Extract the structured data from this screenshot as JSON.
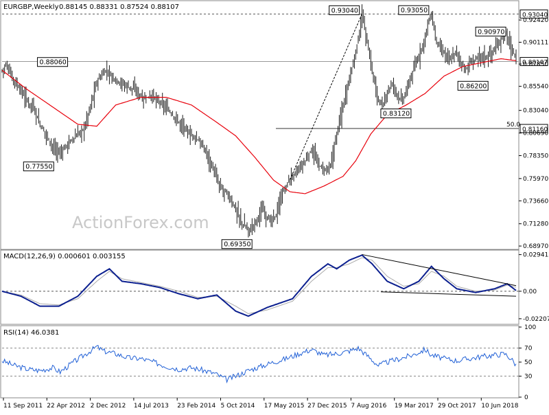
{
  "chart_data": [
    {
      "type": "ohlc",
      "title": "EURGBP,Weekly",
      "ohlc_label": "0.88145 0.88331 0.87524 0.88107",
      "ylim": [
        0.6869,
        0.9435
      ],
      "y_ticks": [
        "0.92420",
        "0.90111",
        "0.87850",
        "0.85540",
        "0.83040",
        "0.80690",
        "0.78350",
        "0.75970",
        "0.73660",
        "0.71280",
        "0.68970"
      ],
      "y_tick_values": [
        0.9242,
        0.90111,
        0.8785,
        0.8554,
        0.8304,
        0.8069,
        0.7835,
        0.7597,
        0.7366,
        0.7128,
        0.6897
      ],
      "x_labels": [
        "11 Sep 2011",
        "22 Apr 2012",
        "2 Dec 2012",
        "14 Jul 2013",
        "23 Feb 2014",
        "5 Oct 2014",
        "17 May 2015",
        "27 Dec 2015",
        "7 Aug 2016",
        "19 Mar 2017",
        "29 Oct 2017",
        "10 Jun 2018"
      ],
      "price_path": [
        [
          0,
          0.872
        ],
        [
          3,
          0.878
        ],
        [
          8,
          0.864
        ],
        [
          14,
          0.852
        ],
        [
          20,
          0.84
        ],
        [
          25,
          0.833
        ],
        [
          30,
          0.815
        ],
        [
          35,
          0.805
        ],
        [
          41,
          0.79
        ],
        [
          46,
          0.786
        ],
        [
          52,
          0.796
        ],
        [
          58,
          0.803
        ],
        [
          65,
          0.812
        ],
        [
          75,
          0.86
        ],
        [
          82,
          0.872
        ],
        [
          88,
          0.864
        ],
        [
          95,
          0.858
        ],
        [
          105,
          0.852
        ],
        [
          112,
          0.842
        ],
        [
          118,
          0.846
        ],
        [
          125,
          0.838
        ],
        [
          132,
          0.83
        ],
        [
          140,
          0.818
        ],
        [
          148,
          0.806
        ],
        [
          155,
          0.8
        ],
        [
          162,
          0.786
        ],
        [
          168,
          0.766
        ],
        [
          172,
          0.752
        ],
        [
          178,
          0.744
        ],
        [
          184,
          0.73
        ],
        [
          190,
          0.712
        ],
        [
          196,
          0.706
        ],
        [
          201,
          0.716
        ],
        [
          206,
          0.728
        ],
        [
          212,
          0.715
        ],
        [
          217,
          0.722
        ],
        [
          222,
          0.745
        ],
        [
          228,
          0.76
        ],
        [
          234,
          0.768
        ],
        [
          240,
          0.778
        ],
        [
          245,
          0.79
        ],
        [
          250,
          0.775
        ],
        [
          255,
          0.768
        ],
        [
          260,
          0.772
        ],
        [
          265,
          0.808
        ],
        [
          270,
          0.836
        ],
        [
          274,
          0.86
        ],
        [
          278,
          0.88
        ],
        [
          282,
          0.905
        ],
        [
          285,
          0.93
        ],
        [
          289,
          0.9
        ],
        [
          293,
          0.87
        ],
        [
          297,
          0.845
        ],
        [
          301,
          0.833
        ],
        [
          305,
          0.85
        ],
        [
          309,
          0.858
        ],
        [
          313,
          0.846
        ],
        [
          317,
          0.84
        ],
        [
          321,
          0.855
        ],
        [
          325,
          0.87
        ],
        [
          329,
          0.884
        ],
        [
          333,
          0.898
        ],
        [
          337,
          0.92
        ],
        [
          340,
          0.93
        ],
        [
          343,
          0.905
        ],
        [
          347,
          0.894
        ],
        [
          351,
          0.888
        ],
        [
          355,
          0.882
        ],
        [
          359,
          0.892
        ],
        [
          363,
          0.88
        ],
        [
          367,
          0.872
        ],
        [
          371,
          0.88
        ],
        [
          375,
          0.884
        ],
        [
          379,
          0.888
        ],
        [
          383,
          0.885
        ],
        [
          387,
          0.89
        ],
        [
          391,
          0.895
        ],
        [
          395,
          0.904
        ],
        [
          399,
          0.91
        ],
        [
          402,
          0.898
        ],
        [
          405,
          0.889
        ],
        [
          407,
          0.881
        ]
      ],
      "ma_path": [
        [
          0,
          0.872
        ],
        [
          20,
          0.852
        ],
        [
          40,
          0.834
        ],
        [
          60,
          0.816
        ],
        [
          75,
          0.814
        ],
        [
          90,
          0.836
        ],
        [
          110,
          0.844
        ],
        [
          130,
          0.844
        ],
        [
          150,
          0.836
        ],
        [
          170,
          0.818
        ],
        [
          185,
          0.804
        ],
        [
          200,
          0.782
        ],
        [
          215,
          0.758
        ],
        [
          228,
          0.746
        ],
        [
          240,
          0.744
        ],
        [
          255,
          0.752
        ],
        [
          270,
          0.762
        ],
        [
          280,
          0.778
        ],
        [
          292,
          0.806
        ],
        [
          305,
          0.826
        ],
        [
          320,
          0.836
        ],
        [
          335,
          0.848
        ],
        [
          350,
          0.866
        ],
        [
          365,
          0.876
        ],
        [
          380,
          0.88
        ],
        [
          395,
          0.884
        ],
        [
          407,
          0.882
        ]
      ],
      "x_max": 407,
      "horizontal_levels": [
        {
          "value": 0.9304,
          "label": "0.93040",
          "style": "dashed"
        },
        {
          "value": 0.8811,
          "label": "0.88107",
          "style": "solid-grey"
        },
        {
          "value": 0.8116,
          "label": "0.81160",
          "style": "solid-dark"
        }
      ],
      "fib_label": "50.0",
      "annotations": [
        {
          "label": "0.88060",
          "x": 53,
          "y": 0.8806
        },
        {
          "label": "0.77550",
          "x": 42,
          "y": 0.7755
        },
        {
          "label": "0.69350",
          "x": 199,
          "y": 0.6935
        },
        {
          "label": "0.93040",
          "x": 284,
          "y": 0.9304
        },
        {
          "label": "0.93050",
          "x": 339,
          "y": 0.9305
        },
        {
          "label": "0.83120",
          "x": 301,
          "y": 0.8312
        },
        {
          "label": "0.86200",
          "x": 362,
          "y": 0.862
        },
        {
          "label": "0.90970",
          "x": 400,
          "y": 0.9097
        }
      ],
      "trendline": {
        "from": [
          228,
          0.7585
        ],
        "to": [
          285,
          0.9304
        ]
      }
    },
    {
      "type": "line",
      "title": "MACD(12,26,9) 0.000601 0.003155",
      "ylim": [
        -0.026,
        0.0325
      ],
      "y_ticks": [
        "0.029412",
        "0.00",
        "-0.022074"
      ],
      "y_tick_values": [
        0.029412,
        0.0,
        -0.022074
      ],
      "series": [
        {
          "name": "macd",
          "values": [
            [
              0,
              0.0
            ],
            [
              15,
              -0.004
            ],
            [
              30,
              -0.012
            ],
            [
              45,
              -0.012
            ],
            [
              60,
              -0.004
            ],
            [
              75,
              0.012
            ],
            [
              85,
              0.018
            ],
            [
              95,
              0.008
            ],
            [
              110,
              0.006
            ],
            [
              125,
              0.003
            ],
            [
              140,
              -0.002
            ],
            [
              155,
              -0.006
            ],
            [
              170,
              -0.003
            ],
            [
              185,
              -0.016
            ],
            [
              195,
              -0.02
            ],
            [
              210,
              -0.013
            ],
            [
              230,
              -0.006
            ],
            [
              245,
              0.012
            ],
            [
              258,
              0.022
            ],
            [
              265,
              0.018
            ],
            [
              275,
              0.025
            ],
            [
              285,
              0.029
            ],
            [
              293,
              0.022
            ],
            [
              305,
              0.008
            ],
            [
              318,
              0.002
            ],
            [
              330,
              0.008
            ],
            [
              340,
              0.02
            ],
            [
              350,
              0.01
            ],
            [
              360,
              0.002
            ],
            [
              375,
              -0.001
            ],
            [
              390,
              0.002
            ],
            [
              400,
              0.006
            ],
            [
              407,
              0.0006
            ]
          ]
        },
        {
          "name": "signal",
          "values": [
            [
              0,
              0.0
            ],
            [
              15,
              -0.003
            ],
            [
              30,
              -0.01
            ],
            [
              45,
              -0.011
            ],
            [
              60,
              -0.006
            ],
            [
              75,
              0.008
            ],
            [
              85,
              0.016
            ],
            [
              95,
              0.01
            ],
            [
              110,
              0.007
            ],
            [
              125,
              0.004
            ],
            [
              140,
              0.0
            ],
            [
              155,
              -0.005
            ],
            [
              170,
              -0.004
            ],
            [
              185,
              -0.012
            ],
            [
              195,
              -0.018
            ],
            [
              210,
              -0.015
            ],
            [
              230,
              -0.008
            ],
            [
              245,
              0.008
            ],
            [
              258,
              0.019
            ],
            [
              265,
              0.019
            ],
            [
              275,
              0.022
            ],
            [
              285,
              0.027
            ],
            [
              293,
              0.025
            ],
            [
              305,
              0.012
            ],
            [
              318,
              0.004
            ],
            [
              330,
              0.006
            ],
            [
              340,
              0.016
            ],
            [
              350,
              0.012
            ],
            [
              360,
              0.004
            ],
            [
              375,
              0.0
            ],
            [
              390,
              0.001
            ],
            [
              400,
              0.005
            ],
            [
              407,
              0.0032
            ]
          ]
        }
      ],
      "trendlines": [
        {
          "from": [
            285,
            0.0295
          ],
          "to": [
            407,
            0.0045
          ]
        },
        {
          "from": [
            300,
            -0.0005
          ],
          "to": [
            407,
            -0.004
          ]
        }
      ]
    },
    {
      "type": "line",
      "title": "RSI(14) 46.0381",
      "ylim": [
        0,
        100
      ],
      "y_ticks": [
        "100",
        "70",
        "50",
        "30",
        "0"
      ],
      "y_tick_values": [
        100,
        70,
        50,
        30,
        0
      ],
      "dashed_levels": [
        70,
        30
      ],
      "series": [
        {
          "name": "rsi",
          "values": [
            [
              0,
              52
            ],
            [
              10,
              45
            ],
            [
              20,
              40
            ],
            [
              30,
              38
            ],
            [
              40,
              42
            ],
            [
              46,
              36
            ],
            [
              55,
              48
            ],
            [
              65,
              60
            ],
            [
              75,
              72
            ],
            [
              80,
              66
            ],
            [
              90,
              62
            ],
            [
              100,
              56
            ],
            [
              110,
              55
            ],
            [
              120,
              50
            ],
            [
              130,
              44
            ],
            [
              140,
              40
            ],
            [
              150,
              42
            ],
            [
              160,
              38
            ],
            [
              168,
              34
            ],
            [
              178,
              25
            ],
            [
              185,
              30
            ],
            [
              195,
              38
            ],
            [
              205,
              44
            ],
            [
              215,
              50
            ],
            [
              225,
              55
            ],
            [
              235,
              62
            ],
            [
              245,
              68
            ],
            [
              255,
              60
            ],
            [
              265,
              62
            ],
            [
              275,
              66
            ],
            [
              282,
              70
            ],
            [
              290,
              58
            ],
            [
              298,
              45
            ],
            [
              305,
              50
            ],
            [
              315,
              55
            ],
            [
              325,
              60
            ],
            [
              335,
              68
            ],
            [
              340,
              60
            ],
            [
              350,
              55
            ],
            [
              360,
              52
            ],
            [
              370,
              55
            ],
            [
              380,
              58
            ],
            [
              390,
              60
            ],
            [
              398,
              62
            ],
            [
              403,
              55
            ],
            [
              407,
              46
            ]
          ]
        }
      ]
    }
  ],
  "watermark": "ActionForex.com"
}
